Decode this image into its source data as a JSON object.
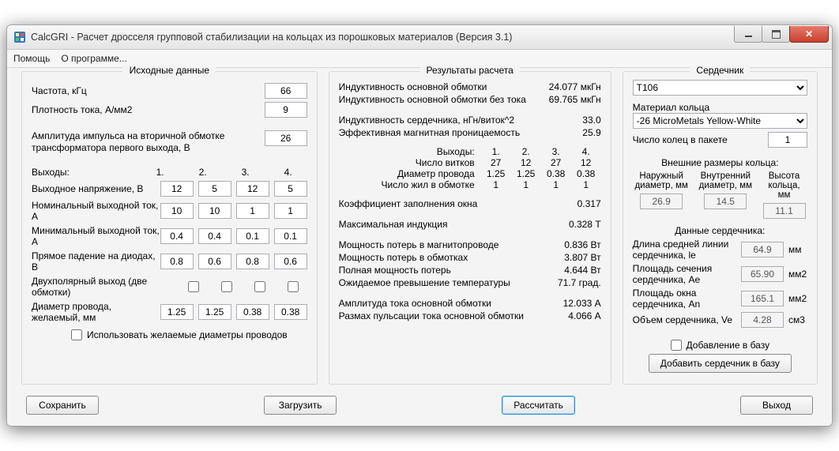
{
  "window": {
    "title": "CalcGRI - Расчет дросселя групповой стабилизации на кольцах из порошковых материалов (Версия 3.1)"
  },
  "menu": {
    "help": "Помощь",
    "about": "О программе..."
  },
  "inputs": {
    "title": "Исходные данные",
    "frequency": {
      "label": "Частота, кГц",
      "value": "66"
    },
    "current_density": {
      "label": "Плотность тока, А/мм2",
      "value": "9"
    },
    "pulse_amp": {
      "label": "Амплитуда импульса на вторичной обмотке трансформатора первого выхода, В",
      "value": "26"
    },
    "outputs_header": "Выходы:",
    "cols": [
      "1.",
      "2.",
      "3.",
      "4."
    ],
    "rows": [
      {
        "label": "Выходное напряжение, В",
        "v": [
          "12",
          "5",
          "12",
          "5"
        ]
      },
      {
        "label": "Номинальный выходной ток, А",
        "v": [
          "10",
          "10",
          "1",
          "1"
        ]
      },
      {
        "label": "Минимальный выходной ток, А",
        "v": [
          "0.4",
          "0.4",
          "0.1",
          "0.1"
        ]
      },
      {
        "label": "Прямое падение на диодах, В",
        "v": [
          "0.8",
          "0.6",
          "0.8",
          "0.6"
        ]
      },
      {
        "label": "Двухполярный выход (две обмотки)",
        "v": [
          false,
          false,
          false,
          false
        ]
      },
      {
        "label": "Диаметр провода, желаемый, мм",
        "v": [
          "1.25",
          "1.25",
          "0.38",
          "0.38"
        ]
      }
    ],
    "use_wire_dia": "Использовать желаемые диаметры проводов"
  },
  "results": {
    "title": "Результаты расчета",
    "out_header": "Выходы:",
    "lines": [
      {
        "k": "Индуктивность основной обмотки",
        "v": "24.077 мкГн"
      },
      {
        "k": "Индуктивность основной обмотки без тока",
        "v": "69.765 мкГн"
      },
      {
        "k": "Индуктивность сердечника, нГн/виток^2",
        "v": "33.0"
      },
      {
        "k": "Эффективная магнитная проницаемость",
        "v": "25.9"
      },
      {
        "k": "Коэффициент заполнения окна",
        "v": "0.317"
      },
      {
        "k": "Максимальная индукция",
        "v": "0.328 Т"
      },
      {
        "k": "Мощность потерь в магнитопроводе",
        "v": "0.836 Вт"
      },
      {
        "k": "Мощность потерь в обмотках",
        "v": "3.807 Вт"
      },
      {
        "k": "Полная мощность потерь",
        "v": "4.644 Вт"
      },
      {
        "k": "Ожидаемое превышение температуры",
        "v": "71.7 град."
      },
      {
        "k": "Амплитуда тока основной обмотки",
        "v": "12.033 А"
      },
      {
        "k": "Размах пульсации тока основной обмотки",
        "v": "4.066 А"
      }
    ],
    "grid": [
      {
        "k": "Число витков",
        "v": [
          "27",
          "12",
          "27",
          "12"
        ]
      },
      {
        "k": "Диаметр провода",
        "v": [
          "1.25",
          "1.25",
          "0.38",
          "0.38"
        ]
      },
      {
        "k": "Число жил в обмотке",
        "v": [
          "1",
          "1",
          "1",
          "1"
        ]
      }
    ]
  },
  "core": {
    "title": "Сердечник",
    "core_select": "T106",
    "material_label": "Материал кольца",
    "material_select": "-26 MicroMetals Yellow-White",
    "stack_label": "Число колец в пакете",
    "stack_value": "1",
    "ext_sizes_title": "Внешние размеры кольца:",
    "ext": [
      {
        "label": "Наружный диаметр, мм",
        "value": "26.9"
      },
      {
        "label": "Внутренний диаметр, мм",
        "value": "14.5"
      },
      {
        "label": "Высота кольца, мм",
        "value": "11.1"
      }
    ],
    "data_title": "Данные сердечника:",
    "params": [
      {
        "k": "Длина средней линии сердечника, le",
        "v": "64.9",
        "u": "мм"
      },
      {
        "k": "Площадь сечения сердечника, Ae",
        "v": "65.90",
        "u": "мм2"
      },
      {
        "k": "Площадь окна сердечника, An",
        "v": "165.1",
        "u": "мм2"
      },
      {
        "k": "Объем сердечника, Ve",
        "v": "4.28",
        "u": "см3"
      }
    ],
    "add_to_db_label": "Добавление в базу",
    "add_button": "Добавить сердечник в базу"
  },
  "buttons": {
    "save": "Сохранить",
    "load": "Загрузить",
    "calc": "Рассчитать",
    "exit": "Выход"
  }
}
